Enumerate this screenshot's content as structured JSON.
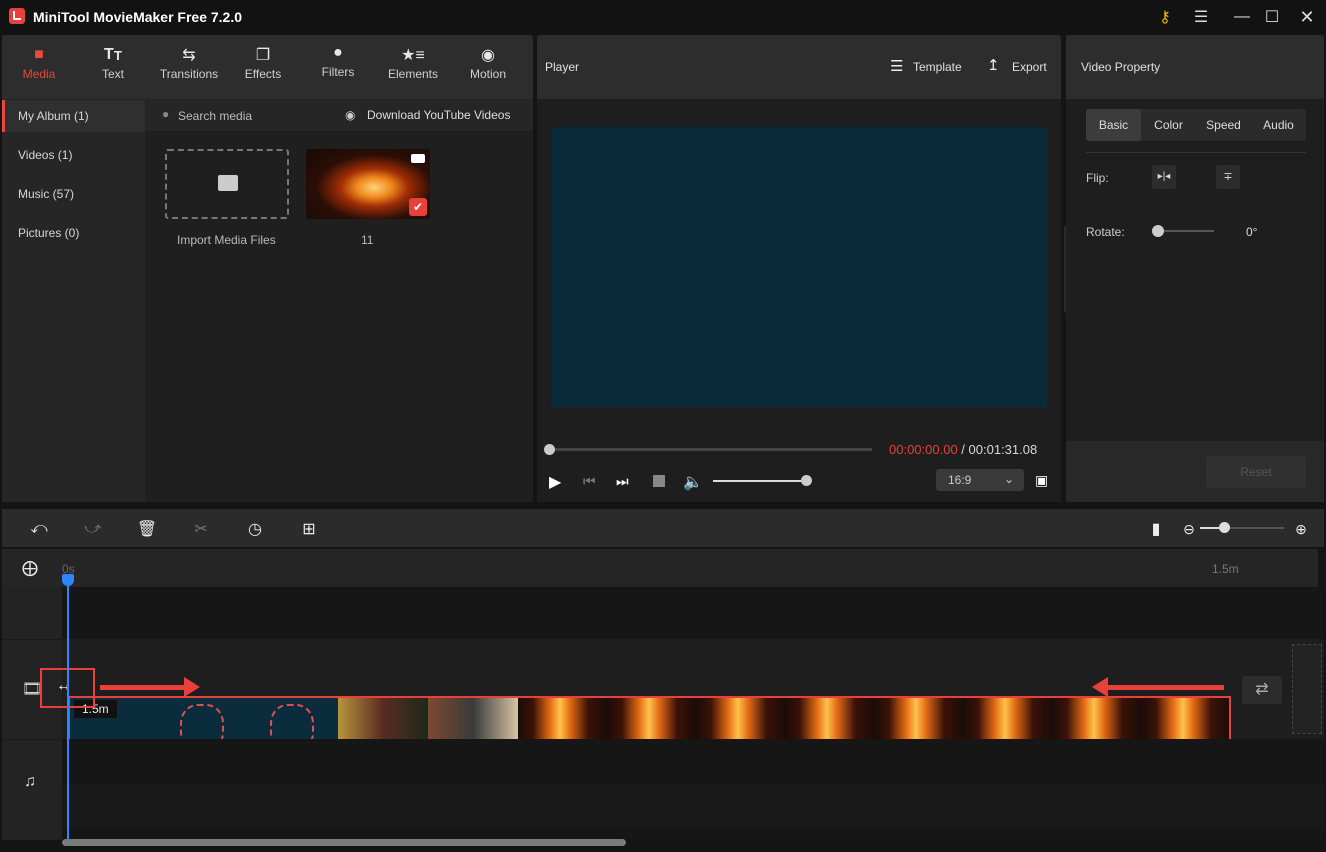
{
  "window": {
    "title": "MiniTool MovieMaker Free 7.2.0",
    "icons": [
      "key-icon",
      "menu-icon",
      "minimize-icon",
      "maximize-icon",
      "close-icon"
    ]
  },
  "tabs": [
    {
      "label": "Media",
      "icon": "folder-icon",
      "active": true
    },
    {
      "label": "Text",
      "icon": "text-icon"
    },
    {
      "label": "Transitions",
      "icon": "transitions-icon"
    },
    {
      "label": "Effects",
      "icon": "effects-icon"
    },
    {
      "label": "Filters",
      "icon": "filters-icon"
    },
    {
      "label": "Elements",
      "icon": "elements-icon"
    },
    {
      "label": "Motion",
      "icon": "motion-icon"
    }
  ],
  "album_nav": [
    {
      "label": "My Album (1)",
      "active": true
    },
    {
      "label": "Videos (1)"
    },
    {
      "label": "Music (57)"
    },
    {
      "label": "Pictures (0)"
    }
  ],
  "media": {
    "search_placeholder": "Search media",
    "download_label": "Download YouTube Videos",
    "import_label": "Import Media Files",
    "items": [
      {
        "name": "11",
        "type": "video",
        "selected": true
      }
    ]
  },
  "player": {
    "title": "Player",
    "template_label": "Template",
    "export_label": "Export",
    "current_time": "00:00:00.00",
    "separator": " / ",
    "total_time": "00:01:31.08",
    "progress": 0,
    "volume": 1.0,
    "aspect_ratio": "16:9"
  },
  "property": {
    "title": "Video Property",
    "tabs": [
      {
        "label": "Basic",
        "active": true
      },
      {
        "label": "Color"
      },
      {
        "label": "Speed"
      },
      {
        "label": "Audio"
      }
    ],
    "flip_label": "Flip:",
    "rotate_label": "Rotate:",
    "rotate_value": "0°",
    "reset_label": "Reset"
  },
  "timeline": {
    "ruler_start": "0s",
    "ruler_end": "1.5m",
    "clip_duration": "1.5m",
    "zoom_level": 0.25,
    "colors": {
      "accent": "#e8403a",
      "playhead": "#2b86ff",
      "audio": "#4a6285"
    }
  }
}
